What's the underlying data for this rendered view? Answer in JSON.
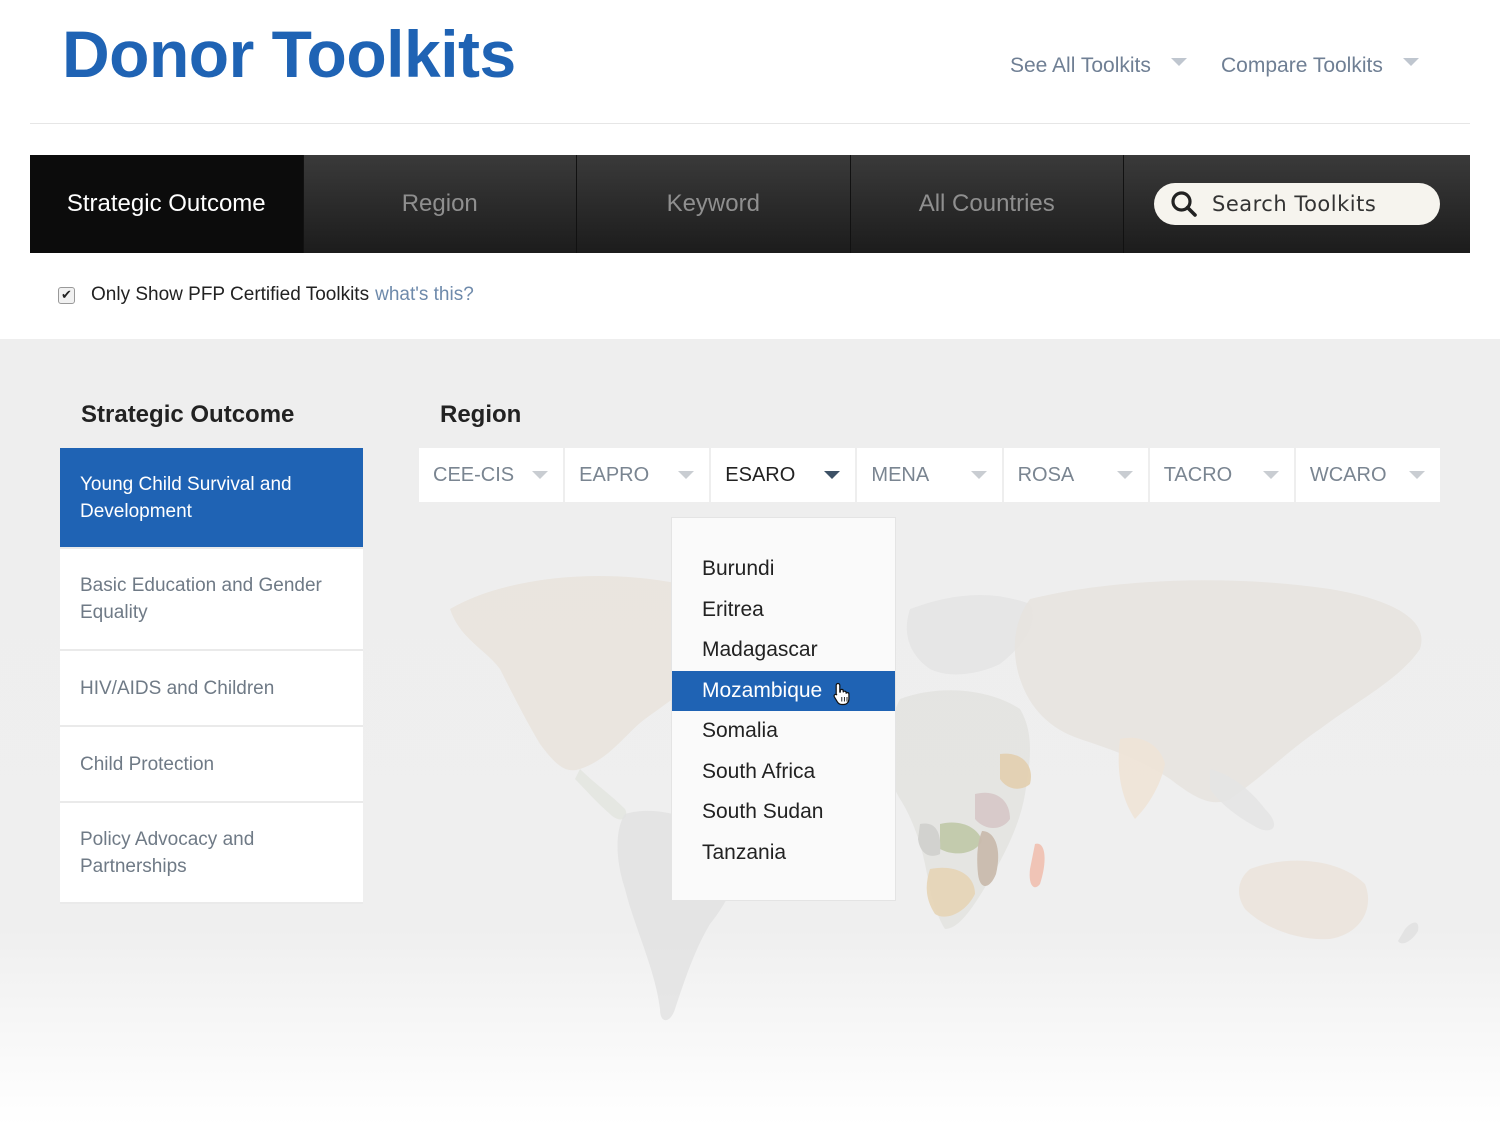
{
  "header": {
    "title": "Donor Toolkits",
    "links": [
      {
        "label": "See All Toolkits"
      },
      {
        "label": "Compare Toolkits"
      }
    ]
  },
  "tabs": [
    {
      "label": "Strategic Outcome",
      "active": true
    },
    {
      "label": "Region"
    },
    {
      "label": "Keyword"
    },
    {
      "label": "All Countries"
    }
  ],
  "search": {
    "placeholder": "Search Toolkits"
  },
  "certified": {
    "label": "Only Show PFP Certified Toolkits",
    "link": "what's this?",
    "checked": true
  },
  "strategic_outcome": {
    "title": "Strategic Outcome",
    "items": [
      {
        "label": "Young Child Survival and Development",
        "active": true
      },
      {
        "label": "Basic Education and Gender Equality"
      },
      {
        "label": "HIV/AIDS and Children"
      },
      {
        "label": "Child Protection"
      },
      {
        "label": "Policy Advocacy and Partnerships"
      }
    ]
  },
  "region": {
    "title": "Region",
    "items": [
      {
        "label": "CEE-CIS"
      },
      {
        "label": "EAPRO"
      },
      {
        "label": "ESARO",
        "active": true
      },
      {
        "label": "MENA"
      },
      {
        "label": "ROSA"
      },
      {
        "label": "TACRO"
      },
      {
        "label": "WCARO"
      }
    ],
    "dropdown": [
      "Burundi",
      "Eritrea",
      "Madagascar",
      "Mozambique",
      "Somalia",
      "South Africa",
      "South Sudan",
      "Tanzania"
    ],
    "dropdown_selected": "Mozambique"
  },
  "colors": {
    "brand": "#1f63b4",
    "tabbar": "#1c1c1c",
    "link": "#6e8aab"
  }
}
